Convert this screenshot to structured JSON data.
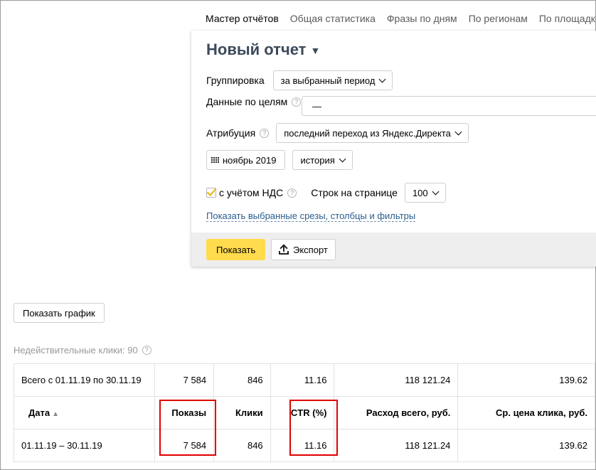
{
  "tabs": [
    {
      "label": "Мастер отчётов",
      "active": true
    },
    {
      "label": "Общая статистика",
      "active": false
    },
    {
      "label": "Фразы по дням",
      "active": false
    },
    {
      "label": "По регионам",
      "active": false
    },
    {
      "label": "По площадкам",
      "active": false
    }
  ],
  "report": {
    "title": "Новый отчет",
    "grouping_label": "Группировка",
    "grouping_value": "за выбранный период",
    "goals_label": "Данные по целям",
    "goals_value": "—",
    "attribution_label": "Атрибуция",
    "attribution_value": "последний переход из Яндекс.Директа",
    "period_value": "ноябрь 2019",
    "history_value": "история",
    "vat_label": "с учётом НДС",
    "vat_checked": true,
    "rows_label": "Строк на странице",
    "rows_value": "100",
    "show_slices_link": "Показать выбранные срезы, столбцы и фильтры",
    "show_button": "Показать",
    "export_button": "Экспорт"
  },
  "show_graph_button": "Показать график",
  "invalid_clicks": "Недействительные клики: 90",
  "table": {
    "total_row": [
      "Всего с 01.11.19 по 30.11.19",
      "7 584",
      "846",
      "11.16",
      "118 121.24",
      "139.62"
    ],
    "headers": [
      "Дата",
      "Показы",
      "Клики",
      "CTR (%)",
      "Расход всего, руб.",
      "Ср. цена клика, руб."
    ],
    "rows": [
      [
        "01.11.19 – 30.11.19",
        "7 584",
        "846",
        "11.16",
        "118 121.24",
        "139.62"
      ]
    ]
  },
  "colors": {
    "accent_yellow": "#ffdb4d",
    "active_tab_underline": "#d93a3a",
    "highlight_red": "#e00000",
    "link_blue": "#2a5d8e"
  }
}
